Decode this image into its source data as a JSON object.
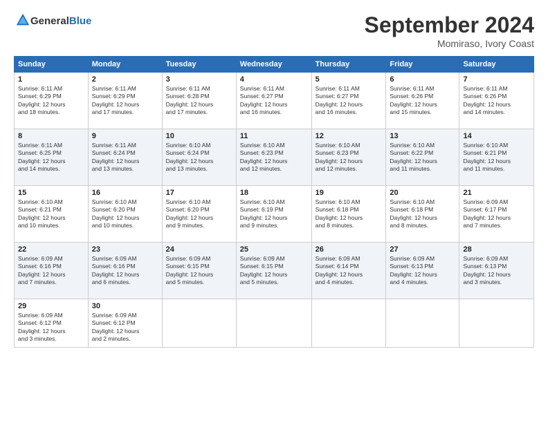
{
  "logo": {
    "general": "General",
    "blue": "Blue"
  },
  "header": {
    "month": "September 2024",
    "location": "Momiraso, Ivory Coast"
  },
  "weekdays": [
    "Sunday",
    "Monday",
    "Tuesday",
    "Wednesday",
    "Thursday",
    "Friday",
    "Saturday"
  ],
  "weeks": [
    [
      {
        "day": "1",
        "sunrise": "6:11 AM",
        "sunset": "6:29 PM",
        "daylight": "12 hours and 18 minutes."
      },
      {
        "day": "2",
        "sunrise": "6:11 AM",
        "sunset": "6:29 PM",
        "daylight": "12 hours and 17 minutes."
      },
      {
        "day": "3",
        "sunrise": "6:11 AM",
        "sunset": "6:28 PM",
        "daylight": "12 hours and 17 minutes."
      },
      {
        "day": "4",
        "sunrise": "6:11 AM",
        "sunset": "6:27 PM",
        "daylight": "12 hours and 16 minutes."
      },
      {
        "day": "5",
        "sunrise": "6:11 AM",
        "sunset": "6:27 PM",
        "daylight": "12 hours and 16 minutes."
      },
      {
        "day": "6",
        "sunrise": "6:11 AM",
        "sunset": "6:26 PM",
        "daylight": "12 hours and 15 minutes."
      },
      {
        "day": "7",
        "sunrise": "6:11 AM",
        "sunset": "6:26 PM",
        "daylight": "12 hours and 14 minutes."
      }
    ],
    [
      {
        "day": "8",
        "sunrise": "6:11 AM",
        "sunset": "6:25 PM",
        "daylight": "12 hours and 14 minutes."
      },
      {
        "day": "9",
        "sunrise": "6:11 AM",
        "sunset": "6:24 PM",
        "daylight": "12 hours and 13 minutes."
      },
      {
        "day": "10",
        "sunrise": "6:10 AM",
        "sunset": "6:24 PM",
        "daylight": "12 hours and 13 minutes."
      },
      {
        "day": "11",
        "sunrise": "6:10 AM",
        "sunset": "6:23 PM",
        "daylight": "12 hours and 12 minutes."
      },
      {
        "day": "12",
        "sunrise": "6:10 AM",
        "sunset": "6:23 PM",
        "daylight": "12 hours and 12 minutes."
      },
      {
        "day": "13",
        "sunrise": "6:10 AM",
        "sunset": "6:22 PM",
        "daylight": "12 hours and 11 minutes."
      },
      {
        "day": "14",
        "sunrise": "6:10 AM",
        "sunset": "6:21 PM",
        "daylight": "12 hours and 11 minutes."
      }
    ],
    [
      {
        "day": "15",
        "sunrise": "6:10 AM",
        "sunset": "6:21 PM",
        "daylight": "12 hours and 10 minutes."
      },
      {
        "day": "16",
        "sunrise": "6:10 AM",
        "sunset": "6:20 PM",
        "daylight": "12 hours and 10 minutes."
      },
      {
        "day": "17",
        "sunrise": "6:10 AM",
        "sunset": "6:20 PM",
        "daylight": "12 hours and 9 minutes."
      },
      {
        "day": "18",
        "sunrise": "6:10 AM",
        "sunset": "6:19 PM",
        "daylight": "12 hours and 9 minutes."
      },
      {
        "day": "19",
        "sunrise": "6:10 AM",
        "sunset": "6:18 PM",
        "daylight": "12 hours and 8 minutes."
      },
      {
        "day": "20",
        "sunrise": "6:10 AM",
        "sunset": "6:18 PM",
        "daylight": "12 hours and 8 minutes."
      },
      {
        "day": "21",
        "sunrise": "6:09 AM",
        "sunset": "6:17 PM",
        "daylight": "12 hours and 7 minutes."
      }
    ],
    [
      {
        "day": "22",
        "sunrise": "6:09 AM",
        "sunset": "6:16 PM",
        "daylight": "12 hours and 7 minutes."
      },
      {
        "day": "23",
        "sunrise": "6:09 AM",
        "sunset": "6:16 PM",
        "daylight": "12 hours and 6 minutes."
      },
      {
        "day": "24",
        "sunrise": "6:09 AM",
        "sunset": "6:15 PM",
        "daylight": "12 hours and 5 minutes."
      },
      {
        "day": "25",
        "sunrise": "6:09 AM",
        "sunset": "6:15 PM",
        "daylight": "12 hours and 5 minutes."
      },
      {
        "day": "26",
        "sunrise": "6:09 AM",
        "sunset": "6:14 PM",
        "daylight": "12 hours and 4 minutes."
      },
      {
        "day": "27",
        "sunrise": "6:09 AM",
        "sunset": "6:13 PM",
        "daylight": "12 hours and 4 minutes."
      },
      {
        "day": "28",
        "sunrise": "6:09 AM",
        "sunset": "6:13 PM",
        "daylight": "12 hours and 3 minutes."
      }
    ],
    [
      {
        "day": "29",
        "sunrise": "6:09 AM",
        "sunset": "6:12 PM",
        "daylight": "12 hours and 3 minutes."
      },
      {
        "day": "30",
        "sunrise": "6:09 AM",
        "sunset": "6:12 PM",
        "daylight": "12 hours and 2 minutes."
      },
      null,
      null,
      null,
      null,
      null
    ]
  ]
}
